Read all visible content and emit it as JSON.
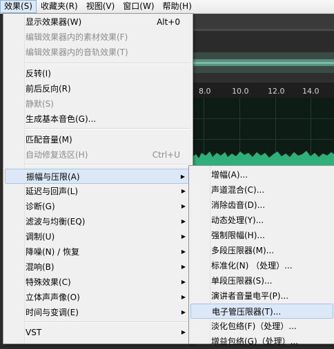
{
  "menubar": [
    {
      "label": "效果(S)",
      "active": true
    },
    {
      "label": "收藏夹(R)",
      "active": false
    },
    {
      "label": "视图(V)",
      "active": false
    },
    {
      "label": "窗口(W)",
      "active": false
    },
    {
      "label": "帮助(H)",
      "active": false
    }
  ],
  "timeline": {
    "ticks": [
      "8.0",
      "10.0",
      "12.0",
      "14.0"
    ]
  },
  "effects_menu": [
    {
      "label": "显示效果器(W)",
      "shortcut": "Alt+0",
      "disabled": false
    },
    {
      "label": "编辑效果器内的素材效果(F)",
      "shortcut": "",
      "disabled": true
    },
    {
      "label": "编辑效果器内的音轨效果(T)",
      "shortcut": "",
      "disabled": true
    },
    {
      "label": "反转(I)",
      "shortcut": "",
      "disabled": false
    },
    {
      "label": "前后反向(R)",
      "shortcut": "",
      "disabled": false
    },
    {
      "label": "静默(S)",
      "shortcut": "",
      "disabled": true
    },
    {
      "label": "生成基本音色(G)...",
      "shortcut": "",
      "disabled": false
    },
    {
      "label": "匹配音量(M)",
      "shortcut": "",
      "disabled": false
    },
    {
      "label": "自动修复选区(H)",
      "shortcut": "Ctrl+U",
      "disabled": true
    },
    {
      "label": "振幅与压限(A)",
      "shortcut": "",
      "disabled": false,
      "submenu": true,
      "highlighted": true
    },
    {
      "label": "延迟与回声(L)",
      "shortcut": "",
      "disabled": false,
      "submenu": true
    },
    {
      "label": "诊断(G)",
      "shortcut": "",
      "disabled": false,
      "submenu": true
    },
    {
      "label": "滤波与均衡(EQ)",
      "shortcut": "",
      "disabled": false,
      "submenu": true
    },
    {
      "label": "调制(U)",
      "shortcut": "",
      "disabled": false,
      "submenu": true
    },
    {
      "label": "降噪(N) / 恢复",
      "shortcut": "",
      "disabled": false,
      "submenu": true
    },
    {
      "label": "混响(B)",
      "shortcut": "",
      "disabled": false,
      "submenu": true
    },
    {
      "label": "特殊效果(C)",
      "shortcut": "",
      "disabled": false,
      "submenu": true
    },
    {
      "label": "立体声声像(O)",
      "shortcut": "",
      "disabled": false,
      "submenu": true
    },
    {
      "label": "时间与变调(E)",
      "shortcut": "",
      "disabled": false,
      "submenu": true
    },
    {
      "label": "VST",
      "shortcut": "",
      "disabled": false,
      "submenu": true
    }
  ],
  "amplitude_submenu": [
    {
      "label": "增幅(A)..."
    },
    {
      "label": "声道混合(C)..."
    },
    {
      "label": "消除齿音(D)..."
    },
    {
      "label": "动态处理(Y)..."
    },
    {
      "label": "强制限幅(H)..."
    },
    {
      "label": "多段压限器(M)..."
    },
    {
      "label": "标准化(N) （处理）..."
    },
    {
      "label": "单段压限器(S)..."
    },
    {
      "label": "演讲者音量电平(P)..."
    },
    {
      "label": "电子管压限器(T)...",
      "highlighted": true
    },
    {
      "label": "淡化包络(F)（处理）..."
    },
    {
      "label": "增益包络(G)（处理）..."
    }
  ]
}
